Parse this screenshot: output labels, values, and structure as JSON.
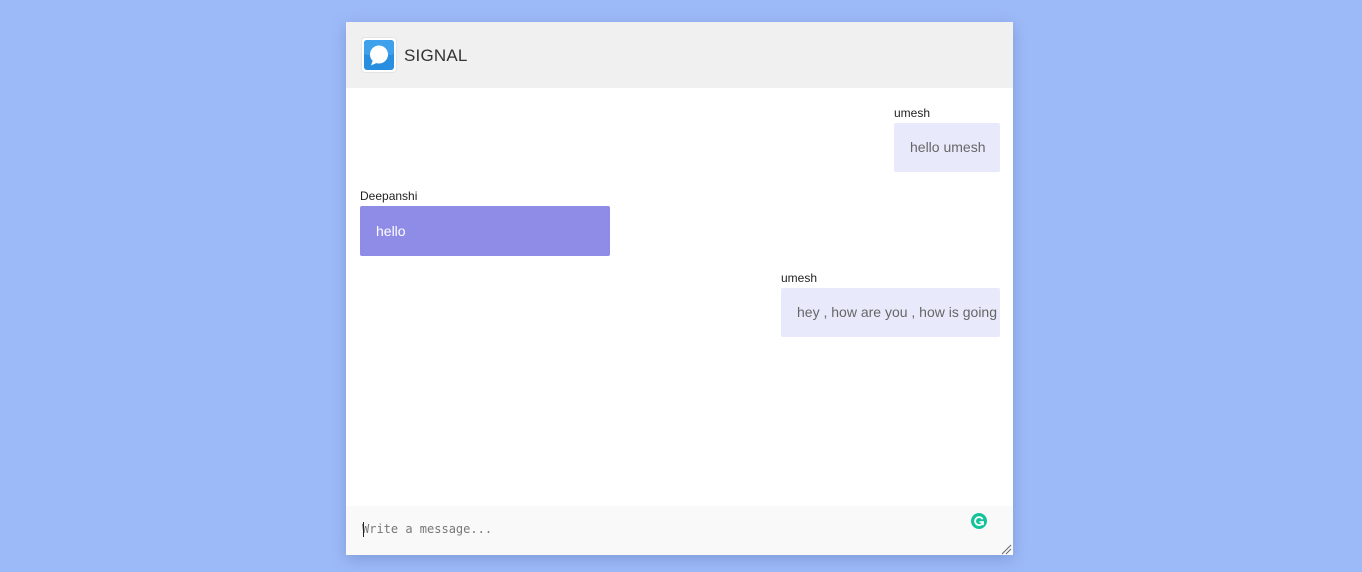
{
  "header": {
    "title": "SIGNAL",
    "logo_icon": "signal-logo-icon"
  },
  "messages": [
    {
      "sender": "umesh",
      "text": "hello umesh",
      "direction": "outgoing"
    },
    {
      "sender": "Deepanshi",
      "text": "hello",
      "direction": "incoming"
    },
    {
      "sender": "umesh",
      "text": "hey , how are you , how is going",
      "direction": "outgoing"
    }
  ],
  "composer": {
    "placeholder": "Write a message...",
    "value": "",
    "assistant_icon": "grammarly-icon"
  },
  "colors": {
    "page_background": "#9dbaf8",
    "header_background": "#f0f0f0",
    "outgoing_bubble": "#e8eafc",
    "incoming_bubble": "#8f8ce8",
    "logo_blue": "#2c6bed",
    "grammar_green": "#15c39a"
  }
}
